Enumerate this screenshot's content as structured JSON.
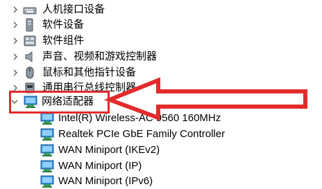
{
  "tree": {
    "categories": [
      {
        "label": "人机接口设备",
        "expanded": false,
        "icon": "hid-icon"
      },
      {
        "label": "软件设备",
        "expanded": false,
        "icon": "software-device-icon"
      },
      {
        "label": "软件组件",
        "expanded": false,
        "icon": "software-component-icon"
      },
      {
        "label": "声音、视频和游戏控制器",
        "expanded": false,
        "icon": "speaker-icon"
      },
      {
        "label": "鼠标和其他指针设备",
        "expanded": false,
        "icon": "mouse-icon"
      },
      {
        "label": "通用串行总线控制器",
        "expanded": false,
        "icon": "usb-controller-icon"
      },
      {
        "label": "网络适配器",
        "expanded": true,
        "icon": "network-adapter-icon"
      }
    ],
    "network_adapters": [
      "Intel(R) Wireless-AC 9560 160MHz",
      "Realtek PCIe GbE Family Controller",
      "WAN Miniport (IKEv2)",
      "WAN Miniport (IP)",
      "WAN Miniport (IPv6)"
    ]
  },
  "annotation": {
    "color": "#e32b2b"
  }
}
